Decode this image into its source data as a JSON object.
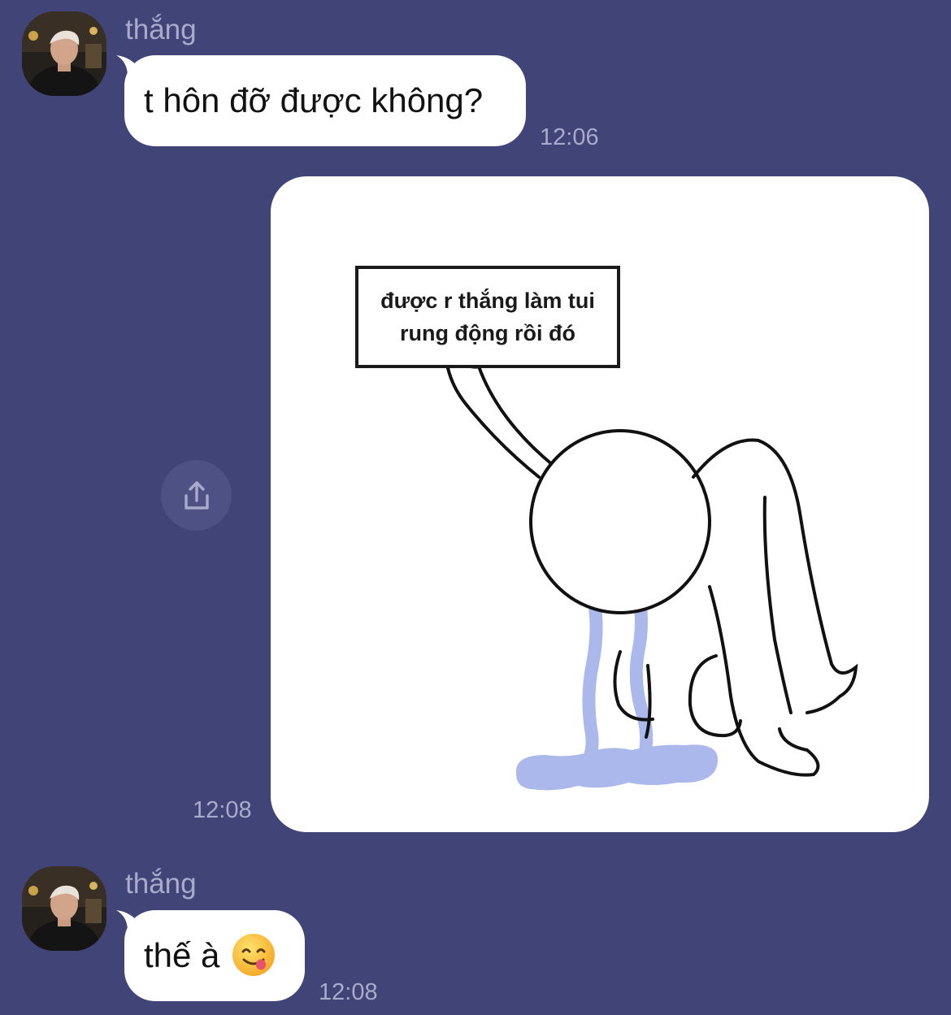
{
  "colors": {
    "background": "#404477",
    "bubble": "#ffffff",
    "meta_text": "#a8abc9",
    "share_button_bg": "#4d5183",
    "tear_blue": "#aab8ec"
  },
  "messages": [
    {
      "sender": "thắng",
      "text": "t hôn đỡ được không?",
      "time": "12:06",
      "type": "text"
    },
    {
      "type": "image",
      "time": "12:08",
      "image_caption_line1": "được r thắng làm tui",
      "image_caption_line2": "rung động rồi đó",
      "share_icon": "share-icon"
    },
    {
      "sender": "thắng",
      "text": "thế à",
      "emoji": "face-savoring-food-emoji",
      "time": "12:08",
      "type": "text"
    }
  ]
}
